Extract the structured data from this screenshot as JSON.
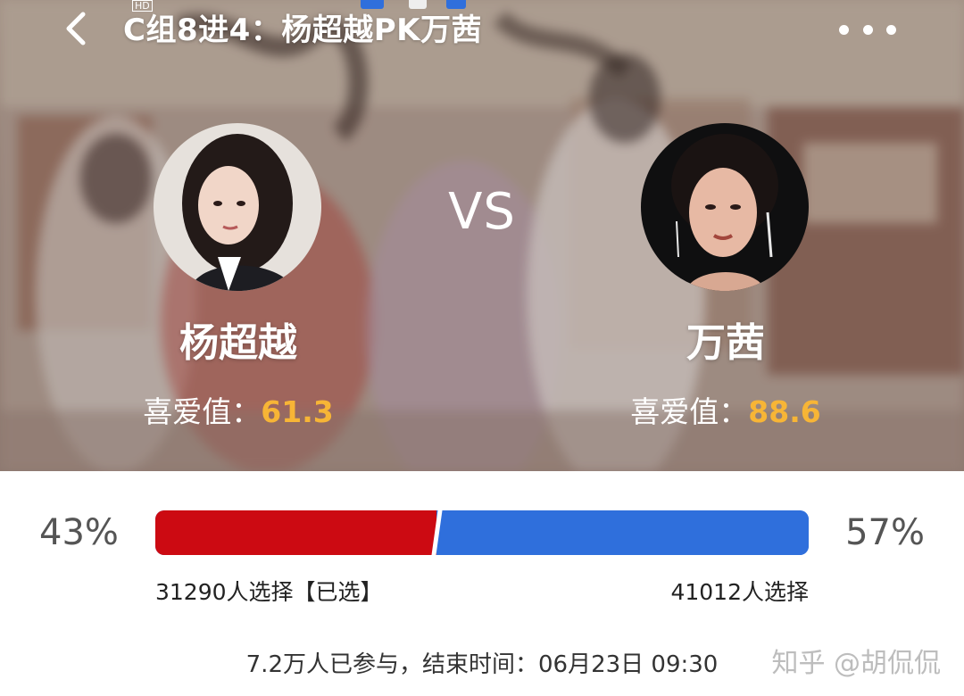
{
  "header": {
    "title": "C组8进4：杨超越PK万茜",
    "hd_badge": "HD"
  },
  "matchup": {
    "vs_label": "VS",
    "left": {
      "name": "杨超越",
      "fav_label": "喜爱值：",
      "fav_value": "61.3",
      "percent": "43%",
      "share": 0.43,
      "count_text": "31290人选择【已选】",
      "bar_color": "#cc0a12"
    },
    "right": {
      "name": "万茜",
      "fav_label": "喜爱值：",
      "fav_value": "88.6",
      "percent": "57%",
      "share": 0.57,
      "count_text": "41012人选择",
      "bar_color": "#2f6fdc"
    }
  },
  "footer": {
    "info": "7.2万人已参与，结束时间：06月23日 09:30",
    "watermark": "知乎 @胡侃侃"
  },
  "icons": {
    "back": "chevron-left-icon",
    "more": "more-dots-icon"
  },
  "colors": {
    "accent_value": "#f7b536",
    "left_bar": "#cc0a12",
    "right_bar": "#2f6fdc"
  }
}
